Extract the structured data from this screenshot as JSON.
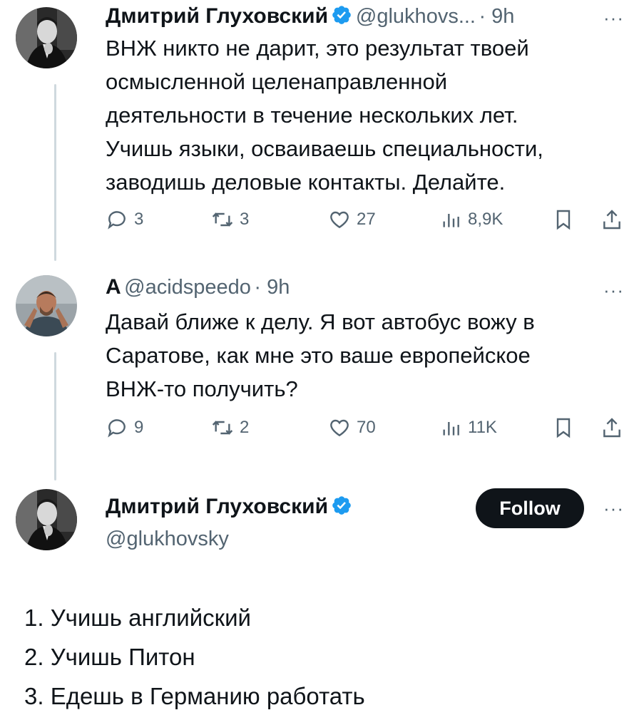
{
  "tweet1": {
    "author_name": "Дмитрий Глуховский",
    "handle": "@glukhovs...",
    "time": "· 9h",
    "more": "···",
    "text": "ВНЖ никто не дарит, это результат твоей\nосмысленной целенаправленной\nдеятельности в течение нескольких лет.\nУчишь языки, осваиваешь специальности,\nзаводишь деловые контакты. Делайте.",
    "replies": "3",
    "retweets": "3",
    "likes": "27",
    "views": "8,9K"
  },
  "tweet2": {
    "author_name": "A",
    "handle": "@acidspeedo",
    "time": "· 9h",
    "more": "···",
    "text": "Давай ближе к делу. Я вот автобус вожу в\nСаратове, как мне это ваше европейское\nВНЖ-то получить?",
    "replies": "9",
    "retweets": "2",
    "likes": "70",
    "views": "11K"
  },
  "tweet3": {
    "author_name": "Дмитрий Глуховский",
    "handle": "@glukhovsky",
    "follow_label": "Follow",
    "more": "···",
    "list": [
      "1. Учишь английский",
      "2. Учишь Питон",
      "3. Едешь в Германию работать"
    ]
  },
  "colors": {
    "text": "#0f1419",
    "secondary": "#536471",
    "verified": "#1d9bf0",
    "thread_line": "#cfd9de",
    "follow_bg": "#0f1419"
  }
}
